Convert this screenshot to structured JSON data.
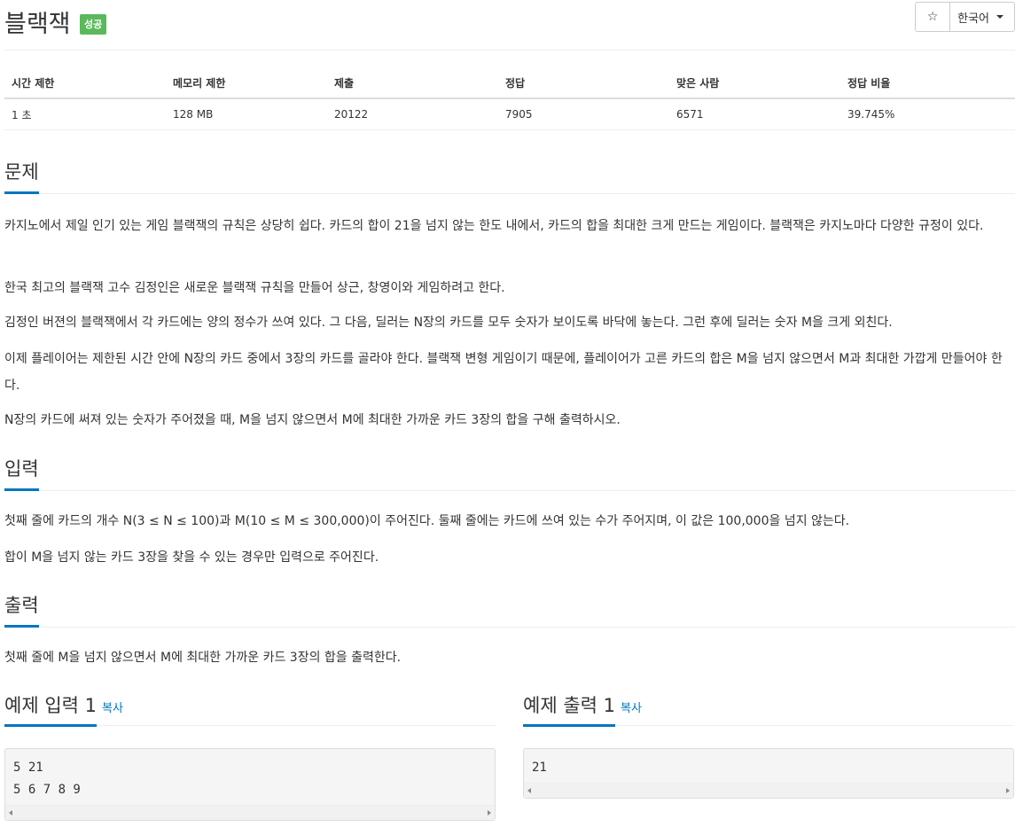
{
  "header": {
    "title": "블랙잭",
    "badge": "성공",
    "star_icon": "☆",
    "language": "한국어"
  },
  "info_table": {
    "headers": [
      "시간 제한",
      "메모리 제한",
      "제출",
      "정답",
      "맞은 사람",
      "정답 비율"
    ],
    "values": [
      "1 초",
      "128 MB",
      "20122",
      "7905",
      "6571",
      "39.745%"
    ]
  },
  "problem": {
    "title": "문제",
    "paragraphs": [
      "카지노에서 제일 인기 있는 게임 블랙잭의 규칙은 상당히 쉽다. 카드의 합이 21을 넘지 않는 한도 내에서, 카드의 합을 최대한 크게 만드는 게임이다. 블랙잭은 카지노마다 다양한 규정이 있다.",
      "한국 최고의 블랙잭 고수 김정인은 새로운 블랙잭 규칙을 만들어 상근, 창영이와 게임하려고 한다.",
      "김정인 버젼의 블랙잭에서 각 카드에는 양의 정수가 쓰여 있다. 그 다음, 딜러는 N장의 카드를 모두 숫자가 보이도록 바닥에 놓는다. 그런 후에 딜러는 숫자 M을 크게 외친다.",
      "이제 플레이어는 제한된 시간 안에 N장의 카드 중에서 3장의 카드를 골라야 한다. 블랙잭 변형 게임이기 때문에, 플레이어가 고른 카드의 합은 M을 넘지 않으면서 M과 최대한 가깝게 만들어야 한다.",
      "N장의 카드에 써져 있는 숫자가 주어졌을 때, M을 넘지 않으면서 M에 최대한 가까운 카드 3장의 합을 구해 출력하시오."
    ]
  },
  "input": {
    "title": "입력",
    "paragraphs": [
      "첫째 줄에 카드의 개수 N(3 ≤ N ≤ 100)과 M(10 ≤ M ≤ 300,000)이 주어진다. 둘째 줄에는 카드에 쓰여 있는 수가 주어지며, 이 값은 100,000을 넘지 않는다.",
      "합이 M을 넘지 않는 카드 3장을 찾을 수 있는 경우만 입력으로 주어진다."
    ]
  },
  "output": {
    "title": "출력",
    "paragraphs": [
      "첫째 줄에 M을 넘지 않으면서 M에 최대한 가까운 카드 3장의 합을 출력한다."
    ]
  },
  "examples": {
    "input_title": "예제 입력 1",
    "output_title": "예제 출력 1",
    "copy_label": "복사",
    "input_text": "5 21\n5 6 7 8 9",
    "output_text": "21"
  }
}
